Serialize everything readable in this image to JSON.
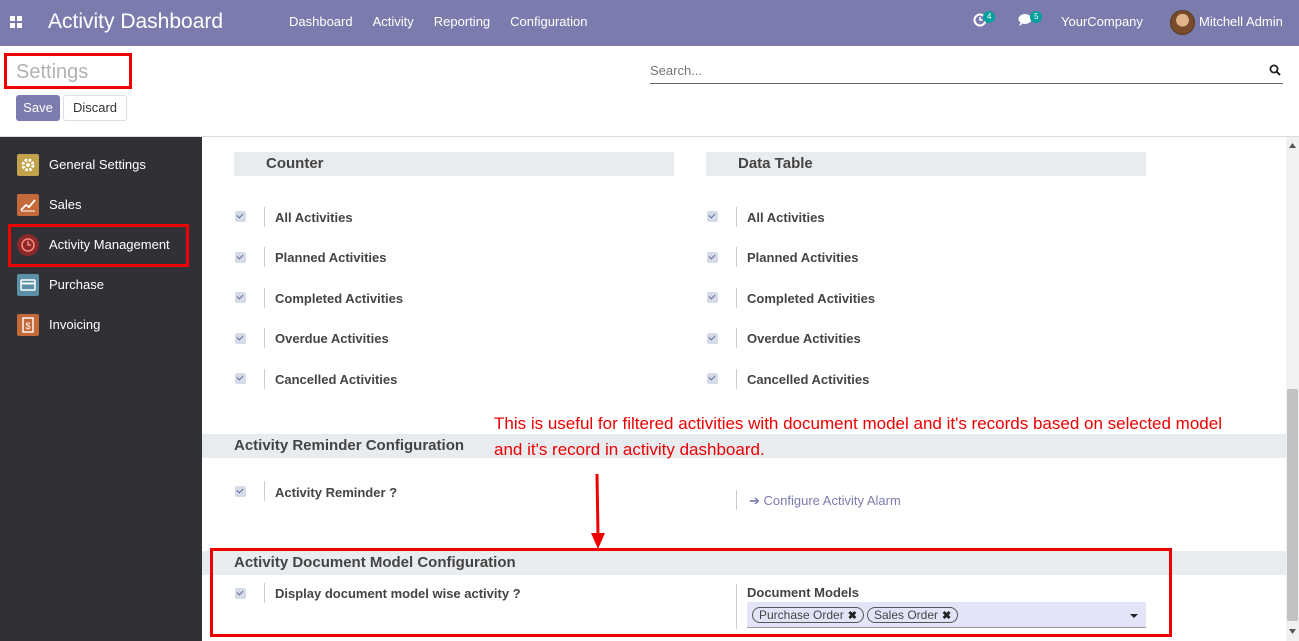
{
  "navbar": {
    "app_title": "Activity Dashboard",
    "menu": [
      "Dashboard",
      "Activity",
      "Reporting",
      "Configuration"
    ],
    "activity_badge": "4",
    "message_badge": "5",
    "company": "YourCompany",
    "user": "Mitchell Admin"
  },
  "control": {
    "title": "Settings",
    "search_placeholder": "Search...",
    "save_label": "Save",
    "discard_label": "Discard"
  },
  "sidebar": {
    "items": [
      {
        "label": "General Settings",
        "icon": "gear-icon",
        "color": "#c2a24a"
      },
      {
        "label": "Sales",
        "icon": "chart-line-icon",
        "color": "#c46a3a"
      },
      {
        "label": "Activity Management",
        "icon": "clock-history-icon",
        "color": "#8a2a2a"
      },
      {
        "label": "Purchase",
        "icon": "credit-card-icon",
        "color": "#5b8fa6"
      },
      {
        "label": "Invoicing",
        "icon": "invoice-dollar-icon",
        "color": "#c46a3a"
      }
    ]
  },
  "counter": {
    "heading": "Counter",
    "items": [
      "All Activities",
      "Planned Activities",
      "Completed Activities",
      "Overdue Activities",
      "Cancelled Activities"
    ]
  },
  "data_table": {
    "heading": "Data Table",
    "items": [
      "All Activities",
      "Planned Activities",
      "Completed Activities",
      "Overdue Activities",
      "Cancelled Activities"
    ]
  },
  "reminder": {
    "heading": "Activity Reminder Configuration",
    "option_label": "Activity Reminder ?",
    "link_label": "Configure Activity Alarm"
  },
  "annotation": "This is useful for filtered activities with document model and it's records based on selected model and it's record in activity dashboard.",
  "doc_model": {
    "heading": "Activity Document Model Configuration",
    "option_label": "Display document model wise activity ?",
    "field_label": "Document Models",
    "tags": [
      "Purchase Order",
      "Sales Order"
    ]
  },
  "colors": {
    "brand": "#7c7bad",
    "sidebar_bg": "#2f3136",
    "annotation_red": "#ee0000"
  }
}
